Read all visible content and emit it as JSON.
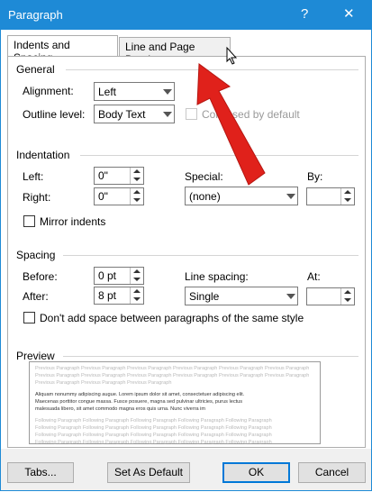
{
  "window": {
    "title": "Paragraph",
    "help": "?",
    "close": "✕"
  },
  "tabs": [
    {
      "label": "Indents and Spacing"
    },
    {
      "label": "Line and Page Breaks"
    }
  ],
  "general": {
    "heading": "General",
    "alignment_label": "Alignment:",
    "alignment_value": "Left",
    "outline_label": "Outline level:",
    "outline_value": "Body Text",
    "collapsed_label": "Collapsed by default",
    "collapsed_checked": false
  },
  "indentation": {
    "heading": "Indentation",
    "left_label": "Left:",
    "left_value": "0\"",
    "right_label": "Right:",
    "right_value": "0\"",
    "special_label": "Special:",
    "special_value": "(none)",
    "by_label": "By:",
    "by_value": "",
    "mirror_label": "Mirror indents",
    "mirror_checked": false
  },
  "spacing": {
    "heading": "Spacing",
    "before_label": "Before:",
    "before_value": "0 pt",
    "after_label": "After:",
    "after_value": "8 pt",
    "line_spacing_label": "Line spacing:",
    "line_spacing_value": "Single",
    "at_label": "At:",
    "at_value": "",
    "dont_add_label": "Don't add space between paragraphs of the same style",
    "dont_add_checked": false
  },
  "preview": {
    "heading": "Preview",
    "previous_lines": [
      "Previous Paragraph Previous Paragraph Previous Paragraph Previous Paragraph Previous Paragraph Previous Paragraph",
      "Previous Paragraph Previous Paragraph Previous Paragraph Previous Paragraph Previous Paragraph Previous Paragraph",
      "Previous Paragraph Previous Paragraph Previous Paragraph"
    ],
    "sample_lines": [
      "Aliquam nonummy adipiscing augue. Lorem ipsum dolor sit amet, consectetuer adipiscing elit.",
      "Maecenas porttitor congue massa. Fusce posuere, magna sed pulvinar ultricies, purus lectus",
      "malesuada libero, sit amet commodo magna eros quis urna. Nunc viverra im"
    ],
    "following_lines": [
      "Following Paragraph Following Paragraph Following Paragraph Following Paragraph Following Paragraph",
      "Following Paragraph Following Paragraph Following Paragraph Following Paragraph Following Paragraph",
      "Following Paragraph Following Paragraph Following Paragraph Following Paragraph Following Paragraph",
      "Following Paragraph Following Paragraph Following Paragraph Following Paragraph Following Paragraph"
    ]
  },
  "buttons": {
    "tabs": "Tabs...",
    "set_default": "Set As Default",
    "ok": "OK",
    "cancel": "Cancel"
  },
  "colors": {
    "titlebar": "#1e8ad6",
    "annotation_arrow": "#e0211b"
  },
  "icons": {
    "cursor": "mouse-pointer-icon",
    "annotation": "red-arrow-icon"
  }
}
